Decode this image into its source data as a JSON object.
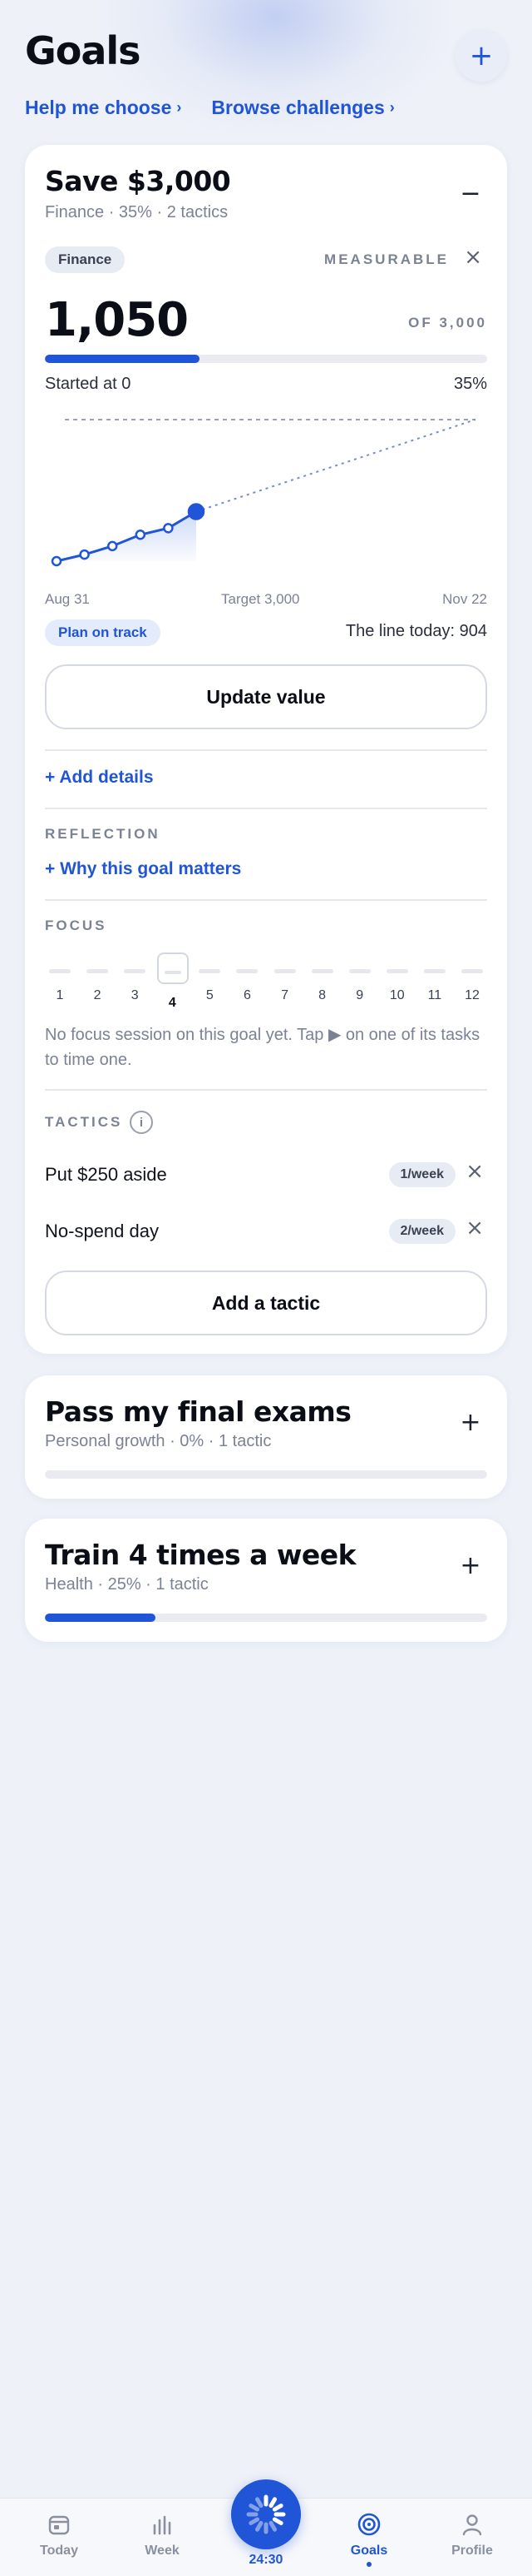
{
  "header": {
    "title": "Goals",
    "add_button": "+",
    "links": [
      {
        "label": "Help me choose",
        "chevron": "›"
      },
      {
        "label": "Browse challenges",
        "chevron": "›"
      }
    ]
  },
  "goal_expanded": {
    "title": "Save $3,000",
    "subtitle": "Finance · 35% · 2 tactics",
    "toggle": "−",
    "category_tag": "Finance",
    "measurable_label": "MEASURABLE",
    "close": "×",
    "current_value": "1,050",
    "of_target": "OF 3,000",
    "progress_fraction": 0.35,
    "started_at": "Started at 0",
    "progress_percent": "35%",
    "chart_axis": {
      "start": "Aug 31",
      "middle": "Target 3,000",
      "end": "Nov 22"
    },
    "status_pill": "Plan on track",
    "line_today": "The line today: 904",
    "update_button": "Update value",
    "add_details": "+ Add details",
    "reflection_label": "REFLECTION",
    "reflection_link": "+ Why this goal matters",
    "focus_label": "FOCUS",
    "focus_weeks": [
      "1",
      "2",
      "3",
      "4",
      "5",
      "6",
      "7",
      "8",
      "9",
      "10",
      "11",
      "12"
    ],
    "focus_current_week": "4",
    "focus_note": "No focus session on this goal yet. Tap ▶ on one of its tasks to time one.",
    "tactics_label": "TACTICS",
    "tactics_info": "i",
    "tactics": [
      {
        "name": "Put $250 aside",
        "frequency": "1/week"
      },
      {
        "name": "No-spend day",
        "frequency": "2/week"
      }
    ],
    "add_tactic_button": "Add a tactic"
  },
  "chart_data": {
    "type": "line",
    "x_range": [
      "Aug 31",
      "Nov 22"
    ],
    "ylim": [
      0,
      3000
    ],
    "target": 3000,
    "series": [
      {
        "values": [
          0,
          140,
          320,
          560,
          700,
          1050
        ]
      }
    ],
    "guideline_today": 904,
    "colors": {
      "actual": "#1f55d6",
      "target_line": "#9aa0ae",
      "projection": "#6f8fd8"
    }
  },
  "goals_collapsed": [
    {
      "title": "Pass my final exams",
      "subtitle": "Personal growth · 0% · 1 tactic",
      "toggle": "+",
      "progress_fraction": 0.0
    },
    {
      "title": "Train 4 times a week",
      "subtitle": "Health · 25% · 1 tactic",
      "toggle": "+",
      "progress_fraction": 0.25
    }
  ],
  "tabbar": {
    "tabs": [
      {
        "label": "Today",
        "icon": "calendar-icon"
      },
      {
        "label": "Week",
        "icon": "bar-chart-icon"
      },
      {
        "label": "Goals",
        "icon": "target-icon"
      },
      {
        "label": "Profile",
        "icon": "person-icon"
      }
    ],
    "active_tab": "Goals",
    "timer": "24:30"
  },
  "colors": {
    "accent": "#1f55d6",
    "background": "#eef1f8",
    "card": "#ffffff",
    "muted_text": "#7b8294"
  }
}
